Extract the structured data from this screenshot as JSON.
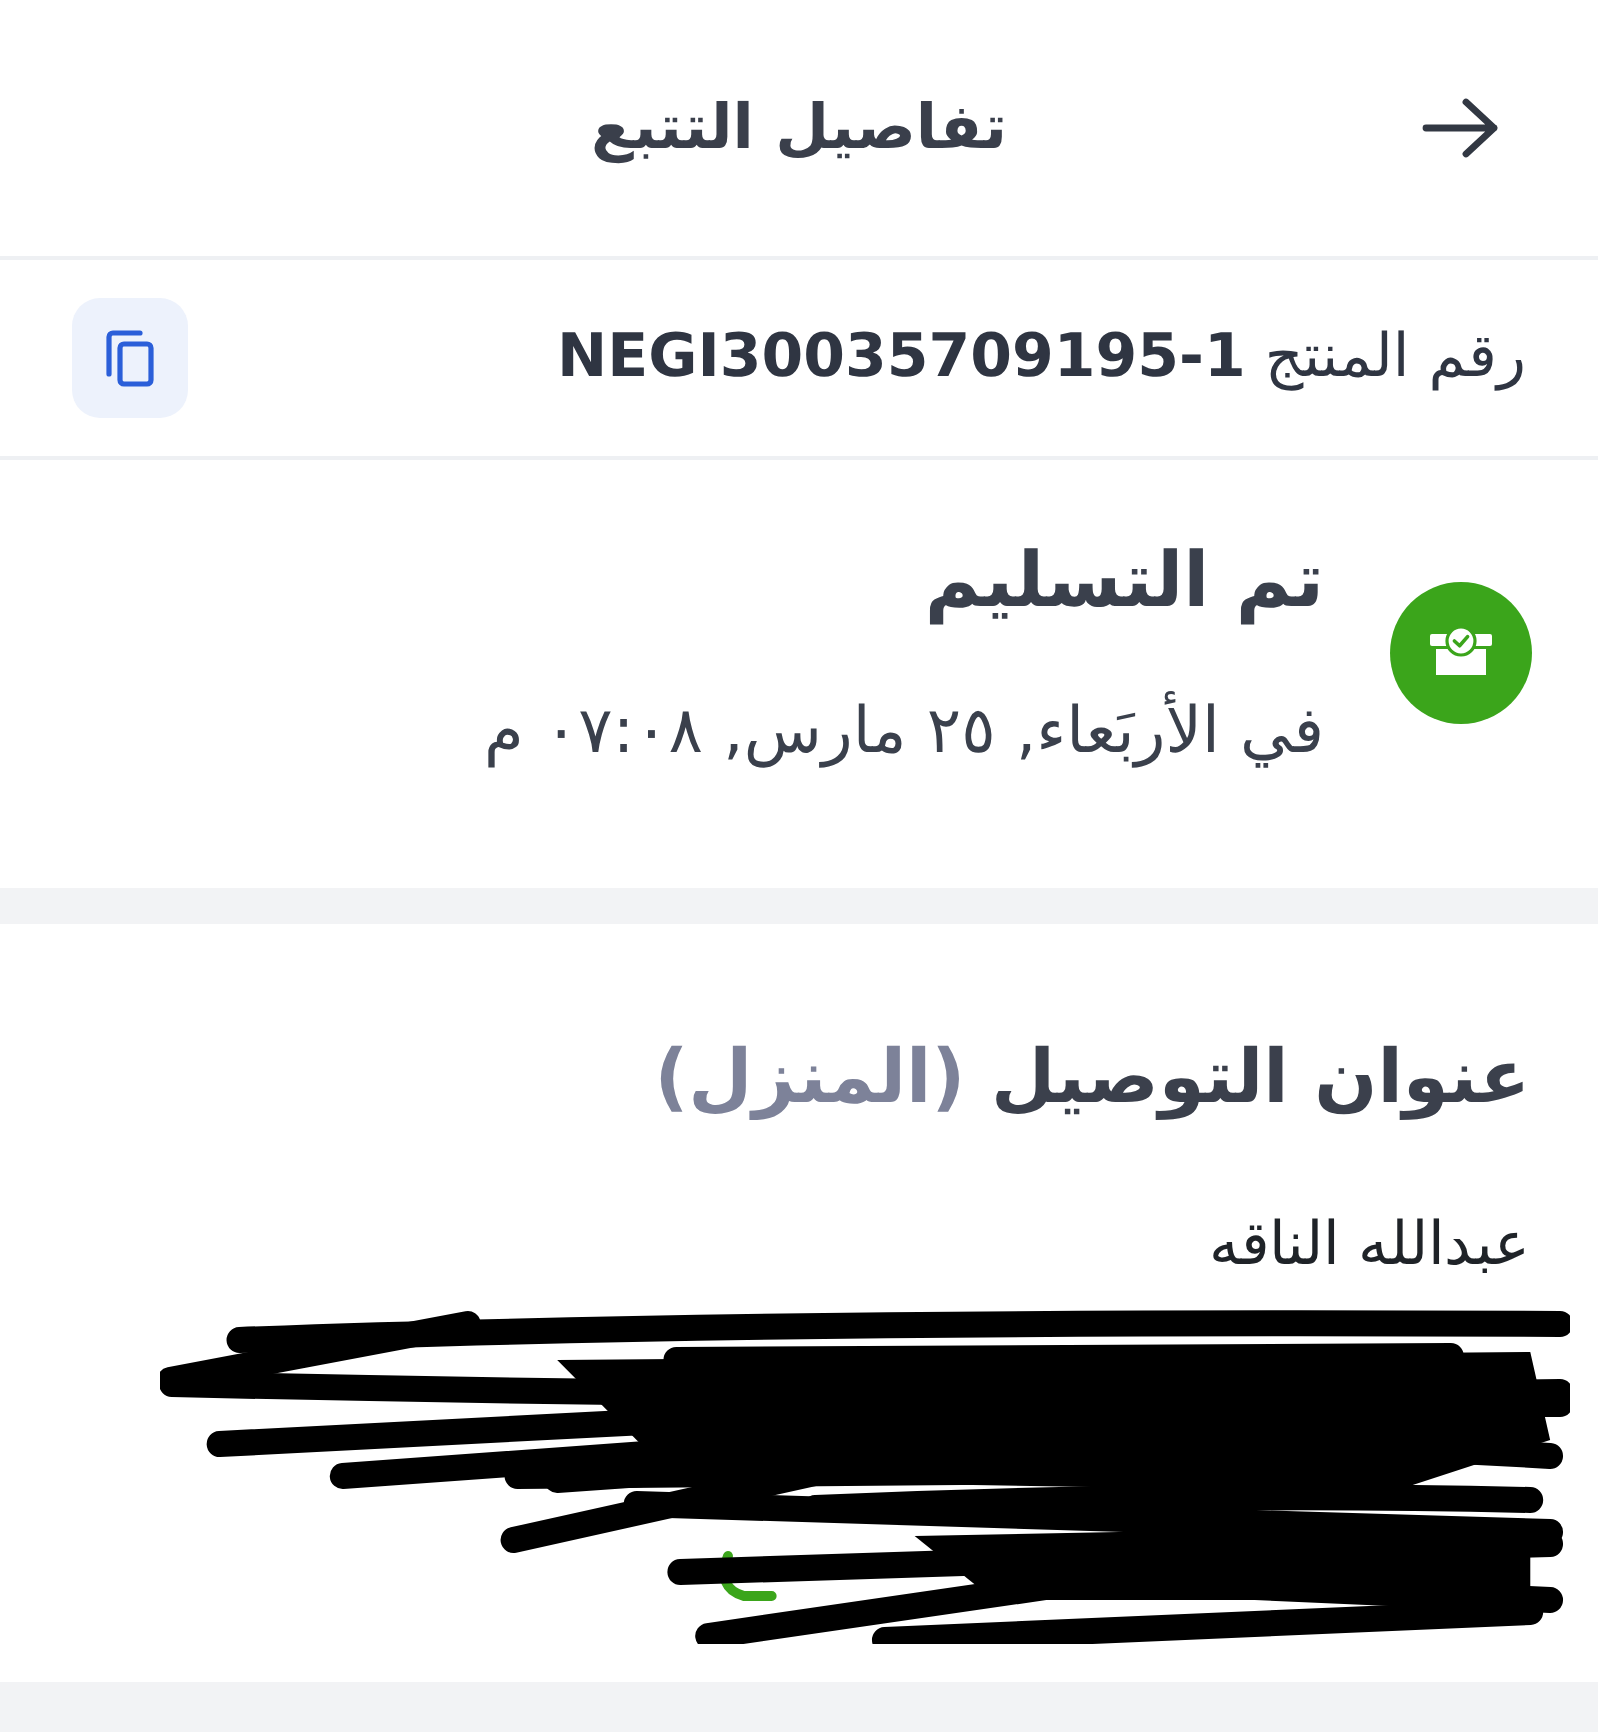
{
  "header": {
    "title": "تفاصيل التتبع"
  },
  "product": {
    "text": "رقم المنتج **NEGI30035709195-1**"
  },
  "status": {
    "kind": "delivered",
    "title": "تم التسليم",
    "date": "في الأربَعاء, ٢٥ مارس, ٠٧:٠٨ م"
  },
  "address": {
    "title": "عنوان التوصيل",
    "type_label": "(المنزل)",
    "name": "عبدالله الناقه",
    "redacted": true
  }
}
